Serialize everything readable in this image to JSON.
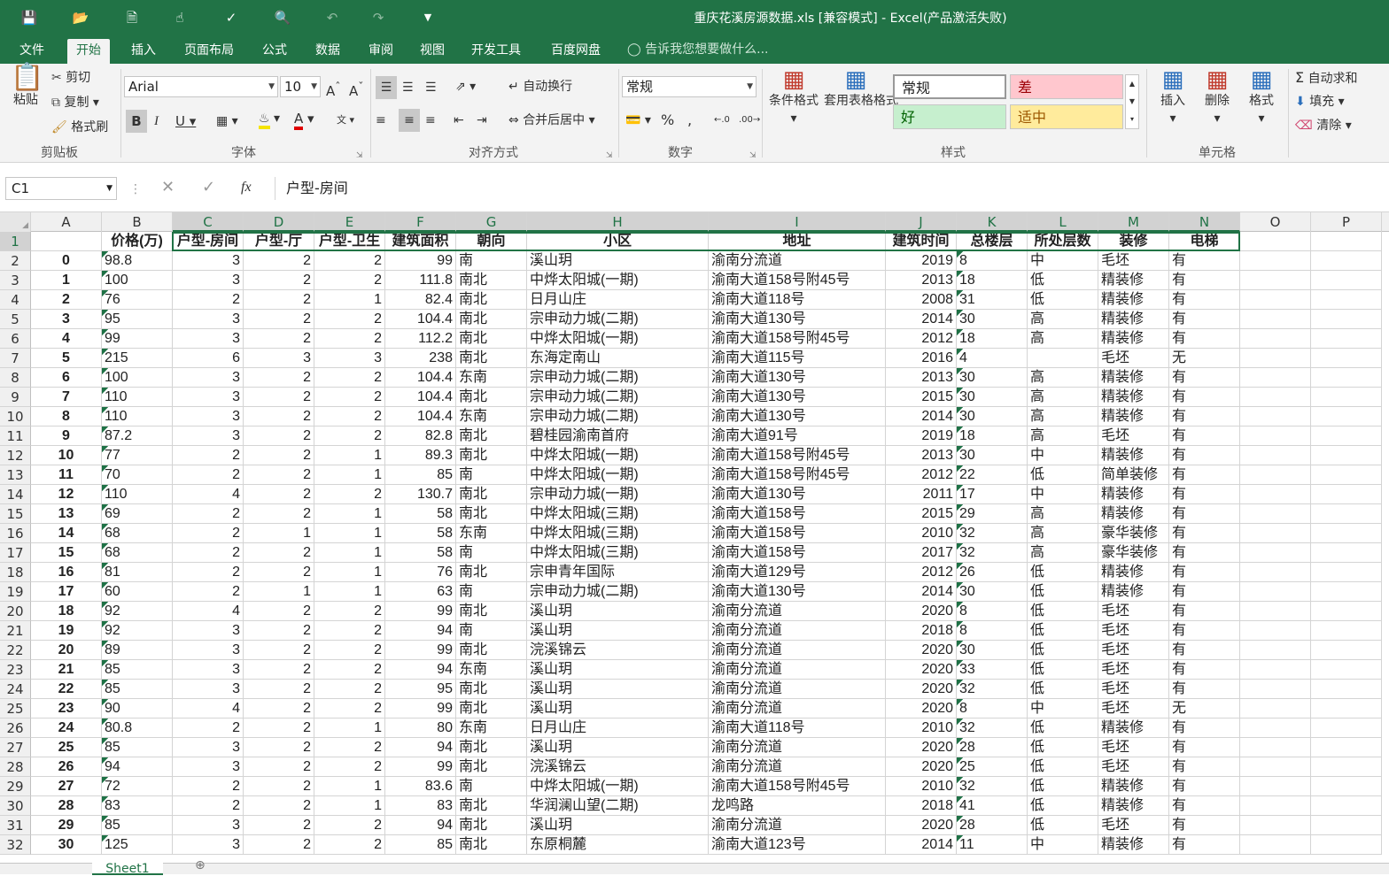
{
  "title": "重庆花溪房源数据.xls  [兼容模式] - Excel(产品激活失败)",
  "tabs": [
    "文件",
    "开始",
    "插入",
    "页面布局",
    "公式",
    "数据",
    "审阅",
    "视图",
    "开发工具",
    "百度网盘"
  ],
  "tell_me": "告诉我您想要做什么...",
  "clipboard": {
    "paste": "粘贴",
    "cut": "剪切",
    "copy": "复制",
    "format_painter": "格式刷",
    "label": "剪贴板"
  },
  "font": {
    "name": "Arial",
    "size": "10",
    "label": "字体"
  },
  "alignment": {
    "wrap": "自动换行",
    "merge": "合并后居中",
    "label": "对齐方式"
  },
  "number": {
    "format": "常规",
    "label": "数字"
  },
  "styles": {
    "cond": "条件格式",
    "table": "套用表格格式",
    "normal": "常规",
    "bad": "差",
    "good": "好",
    "neutral": "适中",
    "label": "样式"
  },
  "cells": {
    "insert": "插入",
    "delete": "删除",
    "format": "格式",
    "label": "单元格"
  },
  "editing": {
    "autosum": "自动求和",
    "fill": "填充",
    "clear": "清除"
  },
  "name_box": "C1",
  "formula": "户型-房间",
  "columns": [
    "A",
    "B",
    "C",
    "D",
    "E",
    "F",
    "G",
    "H",
    "I",
    "J",
    "K",
    "L",
    "M",
    "N",
    "O",
    "P"
  ],
  "header_row": [
    "",
    "价格(万)",
    "户型-房间",
    "户型-厅",
    "户型-卫生",
    "建筑面积",
    "朝向",
    "小区",
    "地址",
    "建筑时间",
    "总楼层",
    "所处层数",
    "装修",
    "电梯"
  ],
  "rows": [
    [
      "0",
      "98.8",
      "3",
      "2",
      "2",
      "99",
      "南",
      "溪山玥",
      "渝南分流道",
      "2019",
      "8",
      "中",
      "毛坯",
      "有"
    ],
    [
      "1",
      "100",
      "3",
      "2",
      "2",
      "111.8",
      "南北",
      "中烨太阳城(一期)",
      "渝南大道158号附45号",
      "2013",
      "18",
      "低",
      "精装修",
      "有"
    ],
    [
      "2",
      "76",
      "2",
      "2",
      "1",
      "82.4",
      "南北",
      "日月山庄",
      "渝南大道118号",
      "2008",
      "31",
      "低",
      "精装修",
      "有"
    ],
    [
      "3",
      "95",
      "3",
      "2",
      "2",
      "104.4",
      "南北",
      "宗申动力城(二期)",
      "渝南大道130号",
      "2014",
      "30",
      "高",
      "精装修",
      "有"
    ],
    [
      "4",
      "99",
      "3",
      "2",
      "2",
      "112.2",
      "南北",
      "中烨太阳城(一期)",
      "渝南大道158号附45号",
      "2012",
      "18",
      "高",
      "精装修",
      "有"
    ],
    [
      "5",
      "215",
      "6",
      "3",
      "3",
      "238",
      "南北",
      "东海定南山",
      "渝南大道115号",
      "2016",
      "4",
      "",
      "毛坯",
      "无"
    ],
    [
      "6",
      "100",
      "3",
      "2",
      "2",
      "104.4",
      "东南",
      "宗申动力城(二期)",
      "渝南大道130号",
      "2013",
      "30",
      "高",
      "精装修",
      "有"
    ],
    [
      "7",
      "110",
      "3",
      "2",
      "2",
      "104.4",
      "南北",
      "宗申动力城(二期)",
      "渝南大道130号",
      "2015",
      "30",
      "高",
      "精装修",
      "有"
    ],
    [
      "8",
      "110",
      "3",
      "2",
      "2",
      "104.4",
      "东南",
      "宗申动力城(二期)",
      "渝南大道130号",
      "2014",
      "30",
      "高",
      "精装修",
      "有"
    ],
    [
      "9",
      "87.2",
      "3",
      "2",
      "2",
      "82.8",
      "南北",
      "碧桂园渝南首府",
      "渝南大道91号",
      "2019",
      "18",
      "高",
      "毛坯",
      "有"
    ],
    [
      "10",
      "77",
      "2",
      "2",
      "1",
      "89.3",
      "南北",
      "中烨太阳城(一期)",
      "渝南大道158号附45号",
      "2013",
      "30",
      "中",
      "精装修",
      "有"
    ],
    [
      "11",
      "70",
      "2",
      "2",
      "1",
      "85",
      "南",
      "中烨太阳城(一期)",
      "渝南大道158号附45号",
      "2012",
      "22",
      "低",
      "简单装修",
      "有"
    ],
    [
      "12",
      "110",
      "4",
      "2",
      "2",
      "130.7",
      "南北",
      "宗申动力城(一期)",
      "渝南大道130号",
      "2011",
      "17",
      "中",
      "精装修",
      "有"
    ],
    [
      "13",
      "69",
      "2",
      "2",
      "1",
      "58",
      "南北",
      "中烨太阳城(三期)",
      "渝南大道158号",
      "2015",
      "29",
      "高",
      "精装修",
      "有"
    ],
    [
      "14",
      "68",
      "2",
      "1",
      "1",
      "58",
      "东南",
      "中烨太阳城(三期)",
      "渝南大道158号",
      "2010",
      "32",
      "高",
      "豪华装修",
      "有"
    ],
    [
      "15",
      "68",
      "2",
      "2",
      "1",
      "58",
      "南",
      "中烨太阳城(三期)",
      "渝南大道158号",
      "2017",
      "32",
      "高",
      "豪华装修",
      "有"
    ],
    [
      "16",
      "81",
      "2",
      "2",
      "1",
      "76",
      "南北",
      "宗申青年国际",
      "渝南大道129号",
      "2012",
      "26",
      "低",
      "精装修",
      "有"
    ],
    [
      "17",
      "60",
      "2",
      "1",
      "1",
      "63",
      "南",
      "宗申动力城(二期)",
      "渝南大道130号",
      "2014",
      "30",
      "低",
      "精装修",
      "有"
    ],
    [
      "18",
      "92",
      "4",
      "2",
      "2",
      "99",
      "南北",
      "溪山玥",
      "渝南分流道",
      "2020",
      "8",
      "低",
      "毛坯",
      "有"
    ],
    [
      "19",
      "92",
      "3",
      "2",
      "2",
      "94",
      "南",
      "溪山玥",
      "渝南分流道",
      "2018",
      "8",
      "低",
      "毛坯",
      "有"
    ],
    [
      "20",
      "89",
      "3",
      "2",
      "2",
      "99",
      "南北",
      "浣溪锦云",
      "渝南分流道",
      "2020",
      "30",
      "低",
      "毛坯",
      "有"
    ],
    [
      "21",
      "85",
      "3",
      "2",
      "2",
      "94",
      "东南",
      "溪山玥",
      "渝南分流道",
      "2020",
      "33",
      "低",
      "毛坯",
      "有"
    ],
    [
      "22",
      "85",
      "3",
      "2",
      "2",
      "95",
      "南北",
      "溪山玥",
      "渝南分流道",
      "2020",
      "32",
      "低",
      "毛坯",
      "有"
    ],
    [
      "23",
      "90",
      "4",
      "2",
      "2",
      "99",
      "南北",
      "溪山玥",
      "渝南分流道",
      "2020",
      "8",
      "中",
      "毛坯",
      "无"
    ],
    [
      "24",
      "80.8",
      "2",
      "2",
      "1",
      "80",
      "东南",
      "日月山庄",
      "渝南大道118号",
      "2010",
      "32",
      "低",
      "精装修",
      "有"
    ],
    [
      "25",
      "85",
      "3",
      "2",
      "2",
      "94",
      "南北",
      "溪山玥",
      "渝南分流道",
      "2020",
      "28",
      "低",
      "毛坯",
      "有"
    ],
    [
      "26",
      "94",
      "3",
      "2",
      "2",
      "99",
      "南北",
      "浣溪锦云",
      "渝南分流道",
      "2020",
      "25",
      "低",
      "毛坯",
      "有"
    ],
    [
      "27",
      "72",
      "2",
      "2",
      "1",
      "83.6",
      "南",
      "中烨太阳城(一期)",
      "渝南大道158号附45号",
      "2010",
      "32",
      "低",
      "精装修",
      "有"
    ],
    [
      "28",
      "83",
      "2",
      "2",
      "1",
      "83",
      "南北",
      "华润澜山望(二期)",
      "龙鸣路",
      "2018",
      "41",
      "低",
      "精装修",
      "有"
    ],
    [
      "29",
      "85",
      "3",
      "2",
      "2",
      "94",
      "南北",
      "溪山玥",
      "渝南分流道",
      "2020",
      "28",
      "低",
      "毛坯",
      "有"
    ],
    [
      "30",
      "125",
      "3",
      "2",
      "2",
      "85",
      "南北",
      "东原桐麓",
      "渝南大道123号",
      "2014",
      "11",
      "中",
      "精装修",
      "有"
    ]
  ],
  "sheet_tab": "Sheet1"
}
